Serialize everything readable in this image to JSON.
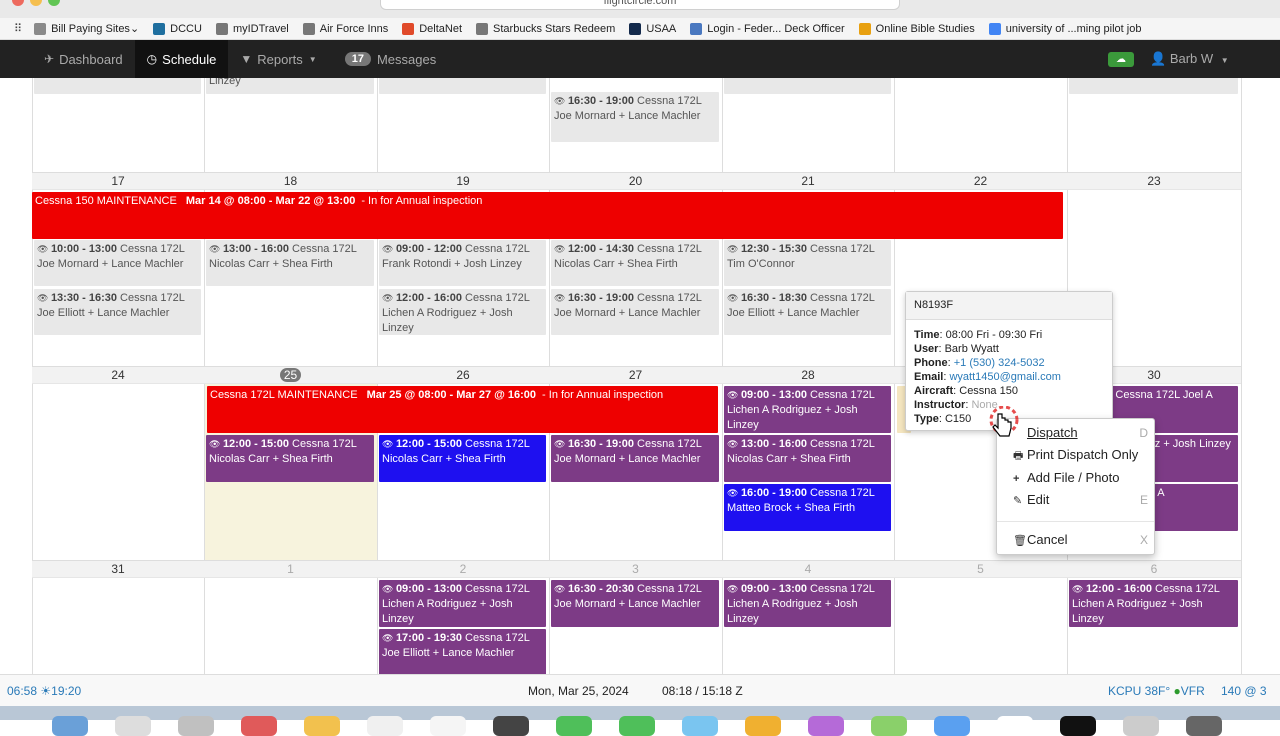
{
  "browser": {
    "url": "flightcircle.com"
  },
  "bookmarks": [
    {
      "label": "Bill Paying Sites",
      "icon": "folder-icon",
      "color": "#8a8a8a",
      "menu": true
    },
    {
      "label": "DCCU",
      "icon": "bird-icon",
      "color": "#1f6f9f"
    },
    {
      "label": "myIDTravel",
      "icon": "globe-icon",
      "color": "#777777"
    },
    {
      "label": "Air Force Inns",
      "icon": "globe-icon",
      "color": "#777777"
    },
    {
      "label": "DeltaNet",
      "icon": "windows-icon",
      "color": "#e04a2a"
    },
    {
      "label": "Starbucks Stars Redeem",
      "icon": "globe-icon",
      "color": "#777777"
    },
    {
      "label": "USAA",
      "icon": "usaa-icon",
      "color": "#13294b"
    },
    {
      "label": "Login - Feder... Deck Officer",
      "icon": "document-icon",
      "color": "#4a78c0"
    },
    {
      "label": "Online Bible Studies",
      "icon": "candle-icon",
      "color": "#e8a010"
    },
    {
      "label": "university of ...ming pilot job",
      "icon": "google-icon",
      "color": "#4285f4"
    }
  ],
  "nav": {
    "dashboard": "Dashboard",
    "schedule": "Schedule",
    "reports": "Reports",
    "messages_count": "17",
    "messages": "Messages",
    "user": "Barb W"
  },
  "colors": {
    "maintenance": "#ee0000",
    "purple": "#7d3b86",
    "blue": "#1e10f0",
    "gray": "#e8e8e8",
    "today": "#f7f3dd"
  },
  "calendar": {
    "week_prev": {
      "events": [
        {
          "col": 1,
          "type": "gray",
          "time": "",
          "text": "Linzey"
        },
        {
          "col": 3,
          "type": "gray",
          "time": "16:30 - 19:00",
          "text": " Cessna 172L Joe Mornard + Lance Machler"
        }
      ]
    },
    "week1": {
      "days": [
        "17",
        "18",
        "19",
        "20",
        "21",
        "22",
        "23"
      ],
      "maintenance": {
        "title": "Cessna 150 MAINTENANCE",
        "range": "Mar 14 @ 08:00 - Mar 22 @ 13:00",
        "note": "- In for Annual inspection"
      },
      "events": [
        {
          "col": 0,
          "row": 0,
          "type": "gray",
          "time": "10:00 - 13:00",
          "text": " Cessna 172L Joe Mornard + Lance Machler"
        },
        {
          "col": 0,
          "row": 1,
          "type": "gray",
          "time": "13:30 - 16:30",
          "text": " Cessna 172L Joe Elliott + Lance Machler"
        },
        {
          "col": 1,
          "row": 0,
          "type": "gray",
          "time": "13:00 - 16:00",
          "text": " Cessna 172L Nicolas Carr + Shea Firth"
        },
        {
          "col": 2,
          "row": 0,
          "type": "gray",
          "time": "09:00 - 12:00",
          "text": " Cessna 172L Frank Rotondi + Josh Linzey"
        },
        {
          "col": 2,
          "row": 1,
          "type": "gray",
          "time": "12:00 - 16:00",
          "text": " Cessna 172L Lichen A Rodriguez + Josh Linzey"
        },
        {
          "col": 3,
          "row": 0,
          "type": "gray",
          "time": "12:00 - 14:30",
          "text": " Cessna 172L Nicolas Carr + Shea Firth"
        },
        {
          "col": 3,
          "row": 1,
          "type": "gray",
          "time": "16:30 - 19:00",
          "text": " Cessna 172L Joe Mornard + Lance Machler"
        },
        {
          "col": 4,
          "row": 0,
          "type": "gray",
          "time": "12:30 - 15:30",
          "text": " Cessna 172L Tim O'Connor",
          "noeye": true
        },
        {
          "col": 4,
          "row": 1,
          "type": "gray",
          "time": "16:30 - 18:30",
          "text": " Cessna 172L Joe Elliott + Lance Machler"
        }
      ]
    },
    "week2": {
      "days": [
        "24",
        "25",
        "26",
        "27",
        "28",
        "29",
        "30"
      ],
      "maintenance": {
        "title": "Cessna 172L MAINTENANCE",
        "range": "Mar 25 @ 08:00 - Mar 27 @ 16:00",
        "note": "- In for Annual inspection"
      },
      "events": [
        {
          "col": 1,
          "row": 0,
          "type": "purple",
          "time": "12:00 - 15:00",
          "text": " Cessna 172L Nicolas Carr + Shea Firth"
        },
        {
          "col": 2,
          "row": 0,
          "type": "blue",
          "time": "12:00 - 15:00",
          "text": " Cessna 172L Nicolas Carr + Shea Firth"
        },
        {
          "col": 3,
          "row": 0,
          "type": "purple",
          "time": "16:30 - 19:00",
          "text": " Cessna 172L Joe Mornard + Lance Machler"
        },
        {
          "col": 4,
          "row": -1,
          "type": "purple",
          "time": "09:00 - 13:00",
          "text": " Cessna 172L Lichen A Rodriguez + Josh Linzey"
        },
        {
          "col": 4,
          "row": 0,
          "type": "purple",
          "time": "13:00 - 16:00",
          "text": " Cessna 172L Nicolas Carr + Shea Firth"
        },
        {
          "col": 4,
          "row": 1,
          "type": "blue",
          "time": "16:00 - 19:00",
          "text": " Cessna 172L Matteo Brock + Shea Firth"
        },
        {
          "col": 6,
          "row": -1,
          "type": "purple",
          "time": "",
          "text": "0:00 - ... Cessna 172L Joel A"
        },
        {
          "col": 6,
          "row": 0,
          "type": "purple",
          "time": "",
          "text": "Cessna 172L ...ez + Josh Linzey"
        },
        {
          "col": 6,
          "row": 1,
          "type": "purple",
          "time": "",
          "text": "...ssna 172L Joel A"
        }
      ]
    },
    "week3": {
      "days": [
        "31",
        "1",
        "2",
        "3",
        "4",
        "5",
        "6"
      ],
      "events": [
        {
          "col": 2,
          "row": 0,
          "type": "purple",
          "time": "09:00 - 13:00",
          "text": " Cessna 172L Lichen A Rodriguez + Josh Linzey"
        },
        {
          "col": 2,
          "row": 1,
          "type": "purple",
          "time": "17:00 - 19:30",
          "text": " Cessna 172L Joe Elliott + Lance Machler"
        },
        {
          "col": 3,
          "row": 0,
          "type": "purple",
          "time": "16:30 - 20:30",
          "text": " Cessna 172L Joe Mornard + Lance Machler"
        },
        {
          "col": 4,
          "row": 0,
          "type": "purple",
          "time": "09:00 - 13:00",
          "text": " Cessna 172L Lichen A Rodriguez + Josh Linzey"
        },
        {
          "col": 6,
          "row": 0,
          "type": "purple",
          "time": "12:00 - 16:00",
          "text": " Cessna 172L Lichen A Rodriguez + Josh Linzey"
        }
      ]
    }
  },
  "popover": {
    "title": "N8193F",
    "time_label": "Time",
    "time": "08:00 Fri - 09:30 Fri",
    "user_label": "User",
    "user": "Barb Wyatt",
    "phone_label": "Phone",
    "phone": "+1 (530) 324-5032",
    "email_label": "Email",
    "email": "wyatt1450@gmail.com",
    "aircraft_label": "Aircraft",
    "aircraft": "Cessna 150",
    "instructor_label": "Instructor",
    "instructor": "None",
    "type_label": "Type",
    "type": "C150"
  },
  "context_menu": {
    "dispatch": "Dispatch",
    "dispatch_key": "D",
    "print": "Print Dispatch Only",
    "add_file": "Add File / Photo",
    "edit": "Edit",
    "edit_key": "E",
    "cancel": "Cancel",
    "cancel_key": "X"
  },
  "footer": {
    "sunrise": "06:58",
    "sunset": "19:20",
    "date": "Mon, Mar 25, 2024",
    "time": "08:18 / 15:18 Z",
    "weather": "KCPU 38F°",
    "vfr": "VFR",
    "wind": "140 @ 3"
  }
}
